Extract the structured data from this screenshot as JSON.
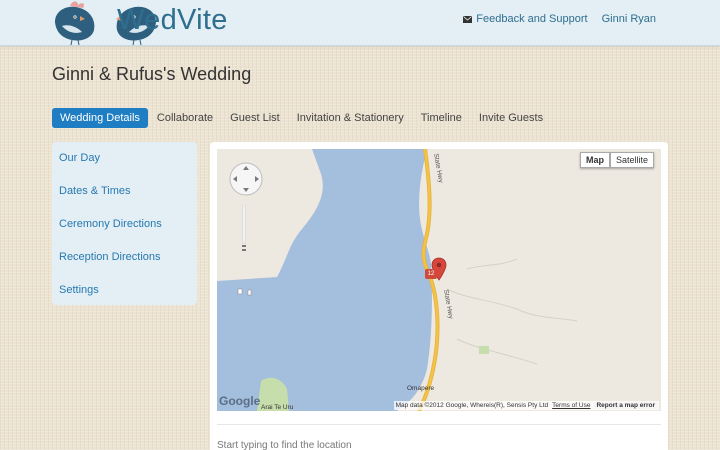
{
  "header": {
    "app_name": "WedVite",
    "feedback_label": "Feedback and Support",
    "user_name": "Ginni Ryan",
    "brand_color": "#2e6e8e"
  },
  "page": {
    "title": "Ginni & Rufus's Wedding"
  },
  "tabs": [
    {
      "label": "Wedding Details",
      "active": true
    },
    {
      "label": "Collaborate",
      "active": false
    },
    {
      "label": "Guest List",
      "active": false
    },
    {
      "label": "Invitation & Stationery",
      "active": false
    },
    {
      "label": "Timeline",
      "active": false
    },
    {
      "label": "Invite Guests",
      "active": false
    }
  ],
  "sidebar": {
    "items": [
      {
        "label": "Our Day"
      },
      {
        "label": "Dates & Times"
      },
      {
        "label": "Ceremony Directions"
      },
      {
        "label": "Reception Directions"
      },
      {
        "label": "Settings"
      }
    ]
  },
  "map": {
    "type_buttons": [
      {
        "label": "Map",
        "selected": true
      },
      {
        "label": "Satellite",
        "selected": false
      }
    ],
    "provider_label": "Google",
    "attribution": "Map data ©2012 Google, Whereis(R), Sensis Pty Ltd",
    "terms_label": "Terms of Use",
    "report_label": "Report a map error",
    "labels": {
      "state_hwy_top": "State Hwy",
      "state_hwy_mid": "State Hwy",
      "town": "Omapere",
      "park": "Arai Te Uru",
      "road_badge": "12"
    },
    "colors": {
      "water": "#a4bedd",
      "land": "#ede9e1",
      "road": "#f4c247",
      "park": "#c6deac",
      "pin": "#d8473b"
    }
  },
  "location": {
    "hint": "Start typing to find the location"
  },
  "accent_color": "#1f7ec3"
}
